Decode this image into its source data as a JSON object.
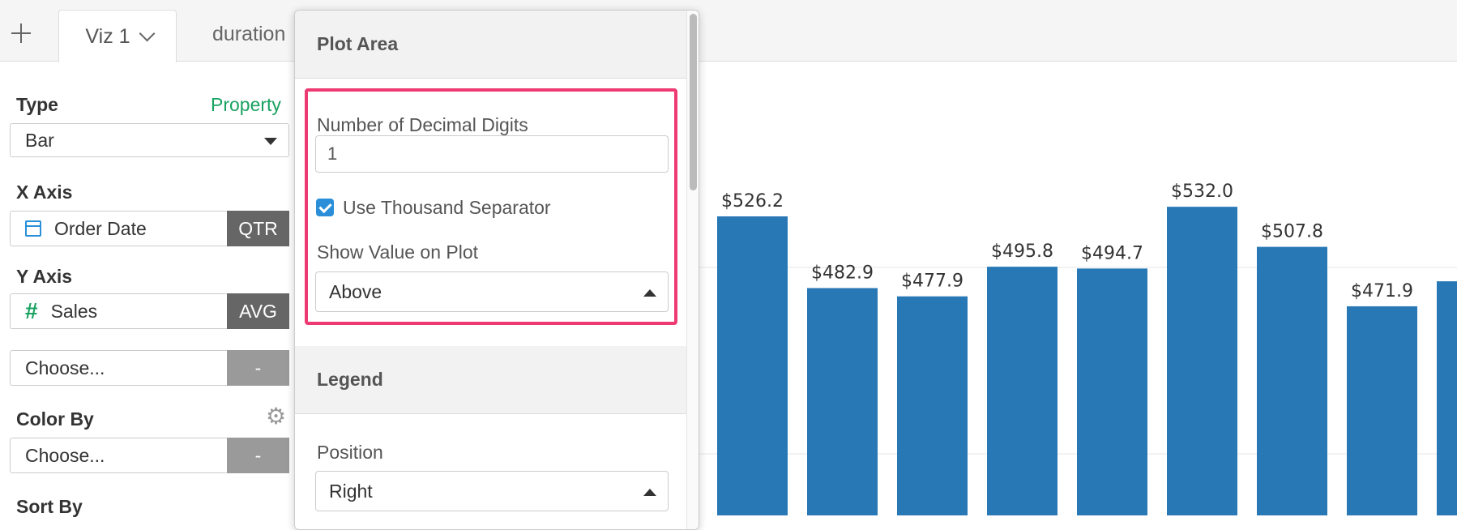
{
  "tabs": [
    {
      "label": "Viz 1"
    },
    {
      "label": "duration"
    }
  ],
  "left_panel": {
    "type_label": "Type",
    "property_link": "Property",
    "type_value": "Bar",
    "x_axis_label": "X Axis",
    "x_field": "Order Date",
    "x_agg": "QTR",
    "y_axis_label": "Y Axis",
    "y_field": "Sales",
    "y_agg": "AVG",
    "extra_field": "Choose...",
    "extra_agg": "-",
    "color_by_label": "Color By",
    "color_field": "Choose...",
    "color_agg": "-",
    "sort_by_label": "Sort By"
  },
  "popover": {
    "plot_area_title": "Plot Area",
    "decimal_label": "Number of Decimal Digits",
    "decimal_value": "1",
    "thousand_sep_label": "Use Thousand Separator",
    "thousand_sep_checked": true,
    "show_value_label": "Show Value on Plot",
    "show_value_selected": "Above",
    "legend_title": "Legend",
    "position_label": "Position",
    "position_selected": "Right"
  },
  "colors": {
    "bar": "#2878b5",
    "highlight": "#ee3a72",
    "accent_green": "#1aa260"
  },
  "chart_data": {
    "type": "bar",
    "values": [
      526.2,
      482.9,
      477.9,
      495.8,
      494.7,
      532.0,
      507.8,
      471.9,
      487.0
    ],
    "labels": [
      "$526.2",
      "$482.9",
      "$477.9",
      "$495.8",
      "$494.7",
      "$532.0",
      "$507.8",
      "$471.9",
      "$"
    ],
    "title": "",
    "xlabel": "",
    "ylabel": ""
  }
}
